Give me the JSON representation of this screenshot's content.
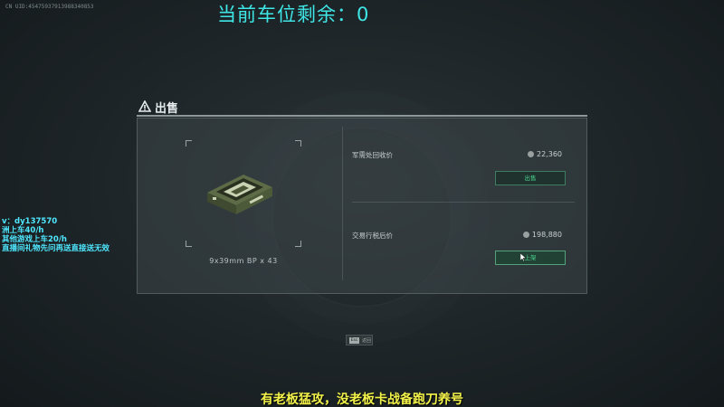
{
  "overlay": {
    "uid": "CN UID:45475937913988340853",
    "top_title": "当前车位剩余：0",
    "stream_lines": [
      "v：dy137570",
      "洲上车40/h",
      "其他游戏上车20/h",
      "直播间礼物先问再送直接送无效"
    ],
    "subtitle": "有老板猛攻，没老板卡战备跑刀养号"
  },
  "dialog": {
    "title": "出售",
    "item_name": "9x39mm BP x 43",
    "offers": [
      {
        "label": "军需处回收价",
        "price": "22,360",
        "button": "出售"
      },
      {
        "label": "交易行税后价",
        "price": "198,880",
        "button": "上架"
      }
    ],
    "escape_key": "Esc",
    "escape_label": "返回"
  },
  "colors": {
    "accent_cyan": "#3fe6e6",
    "button_green": "#4ad48f",
    "subtitle_yellow": "#f2f24a",
    "stream_text": "#4fe8ff"
  },
  "icons": {
    "header": "warning-icon",
    "currency": "coin-icon",
    "item": "ammo-box-icon"
  }
}
